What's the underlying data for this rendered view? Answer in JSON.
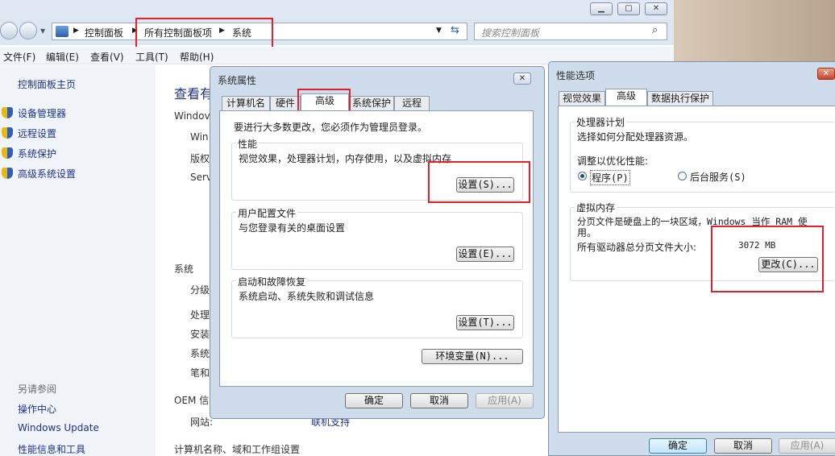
{
  "explorer": {
    "address": {
      "crumb1": "控制面板",
      "crumb2": "所有控制面板项",
      "crumb3": "系统"
    },
    "search_placeholder": "搜索控制面板",
    "menu": [
      "文件(F)",
      "编辑(E)",
      "查看(V)",
      "工具(T)",
      "帮助(H)"
    ],
    "left_pane": {
      "home": "控制面板主页",
      "links": [
        "设备管理器",
        "远程设置",
        "系统保护",
        "高级系统设置"
      ],
      "see_also": "另请参阅",
      "see_also_links": [
        "操作中心",
        "Windows Update",
        "性能信息和工具"
      ]
    },
    "content": {
      "heading": "查看有",
      "windows_edition": "Windov",
      "edition_lines": [
        "Win",
        "版权",
        "Serv"
      ],
      "system_label": "系统",
      "system_lines": [
        "分级",
        "处理",
        "安装",
        "系统",
        "笔和"
      ],
      "oem": "OEM 信",
      "website_label": "网站:",
      "online_support": "联机支持",
      "computer_name_section": "计算机名称、域和工作组设置"
    }
  },
  "sys_props": {
    "title": "系统属性",
    "tabs": [
      "计算机名",
      "硬件",
      "高级",
      "系统保护",
      "远程"
    ],
    "admin_note": "要进行大多数更改，您必须作为管理员登录。",
    "performance": {
      "label": "性能",
      "desc": "视觉效果，处理器计划，内存使用，以及虚拟内存",
      "button": "设置(S)..."
    },
    "profiles": {
      "label": "用户配置文件",
      "desc": "与您登录有关的桌面设置",
      "button": "设置(E)..."
    },
    "startup": {
      "label": "启动和故障恢复",
      "desc": "系统启动、系统失败和调试信息",
      "button": "设置(T)..."
    },
    "env_button": "环境变量(N)...",
    "ok": "确定",
    "cancel": "取消",
    "apply": "应用(A)"
  },
  "perf_opts": {
    "title": "性能选项",
    "tabs": [
      "视觉效果",
      "高级",
      "数据执行保护"
    ],
    "cpu": {
      "label": "处理器计划",
      "desc": "选择如何分配处理器资源。",
      "optimize": "调整以优化性能:",
      "programs": "程序(P)",
      "background": "后台服务(S)"
    },
    "vm": {
      "label": "虚拟内存",
      "desc1": "分页文件是硬盘上的一块区域，Windows 当作 RAM 使",
      "desc2": "用。",
      "total_label": "所有驱动器总分页文件大小:",
      "total_value": "3072 MB",
      "change": "更改(C)..."
    },
    "ok": "确定",
    "cancel": "取消",
    "apply": "应用(A)"
  },
  "colors": {
    "accent": "#1e3287",
    "highlight_box": "#e0202a"
  }
}
